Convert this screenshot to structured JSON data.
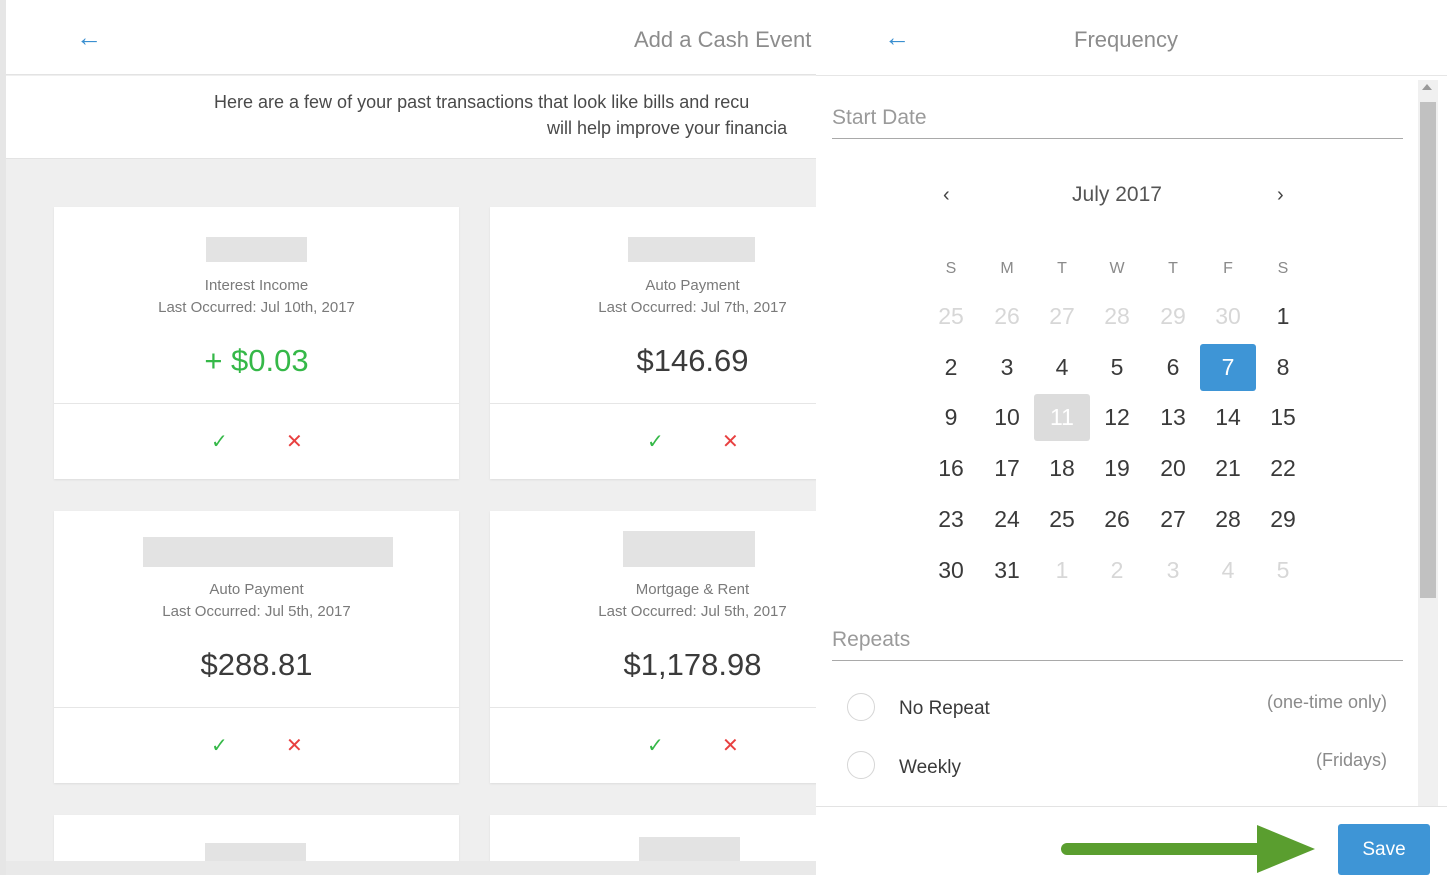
{
  "left": {
    "back_icon": "←",
    "title": "Add a Cash Event",
    "intro_line1": "Here are a few of your past transactions that look like bills and recu",
    "intro_line2": "will help improve your financia",
    "cards": [
      {
        "category": "Interest Income",
        "last": "Last Occurred: Jul 10th, 2017",
        "amount": "+ $0.03"
      },
      {
        "category": "Auto Payment",
        "last": "Last Occurred: Jul 7th, 2017",
        "amount": "$146.69"
      },
      {
        "category": "Auto Payment",
        "last": "Last Occurred: Jul 5th, 2017",
        "amount": "$288.81"
      },
      {
        "category": "Mortgage & Rent",
        "last": "Last Occurred: Jul 5th, 2017",
        "amount": "$1,178.98"
      }
    ],
    "accept_icon": "✓",
    "reject_icon": "✕"
  },
  "right": {
    "back_icon": "←",
    "title": "Frequency",
    "start_date_label": "Start Date",
    "calendar": {
      "prev_icon": "‹",
      "next_icon": "›",
      "month": "July 2017",
      "weekdays": [
        "S",
        "M",
        "T",
        "W",
        "T",
        "F",
        "S"
      ],
      "weeks": [
        [
          "25",
          "26",
          "27",
          "28",
          "29",
          "30",
          "1"
        ],
        [
          "2",
          "3",
          "4",
          "5",
          "6",
          "7",
          "8"
        ],
        [
          "9",
          "10",
          "11",
          "12",
          "13",
          "14",
          "15"
        ],
        [
          "16",
          "17",
          "18",
          "19",
          "20",
          "21",
          "22"
        ],
        [
          "23",
          "24",
          "25",
          "26",
          "27",
          "28",
          "29"
        ],
        [
          "30",
          "31",
          "1",
          "2",
          "3",
          "4",
          "5"
        ]
      ],
      "selected_day": "7",
      "today_day": "11"
    },
    "repeats_label": "Repeats",
    "options": [
      {
        "label": "No Repeat",
        "note": "(one-time only)"
      },
      {
        "label": "Weekly",
        "note": "(Fridays)"
      }
    ],
    "save_label": "Save"
  },
  "colors": {
    "accent": "#3e95d6",
    "positive": "#35b848",
    "negative": "#e84040",
    "annotation_arrow": "#5a9e2f"
  }
}
